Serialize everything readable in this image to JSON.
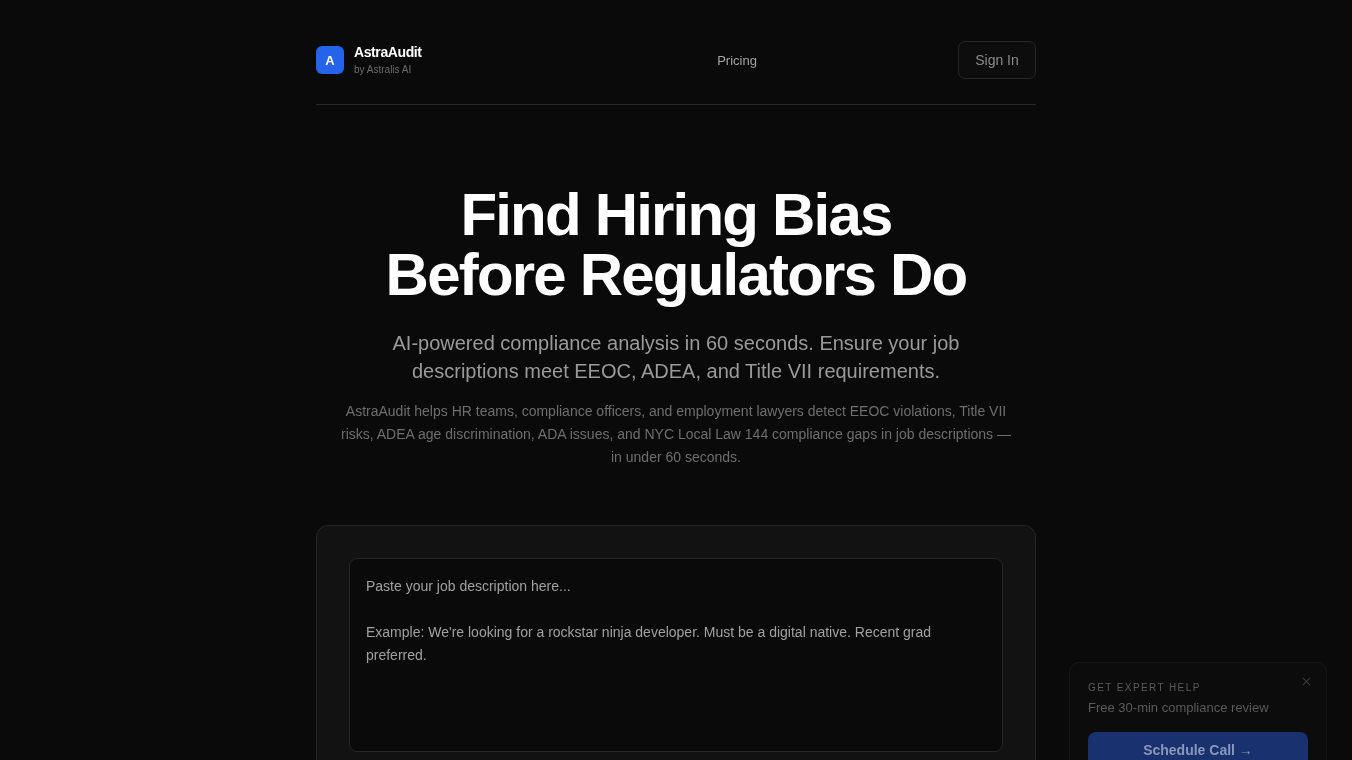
{
  "header": {
    "logo_letter": "A",
    "brand_name": "AstraAudit",
    "tagline": "by Astralis AI",
    "nav": [
      {
        "label": "Pricing"
      }
    ],
    "sign_in": "Sign In"
  },
  "hero": {
    "title_lines": [
      "Find Hiring Bias",
      "Before Regulators Do"
    ],
    "subtitle": "AI-powered compliance analysis in 60 seconds. Ensure your job descriptions meet EEOC, ADEA, and Title VII requirements.",
    "description": "AstraAudit helps HR teams, compliance officers, and employment lawyers detect EEOC violations, Title VII risks, ADEA age discrimination, ADA issues, and NYC Local Law 144 compliance gaps in job descriptions — in under 60 seconds."
  },
  "analyzer": {
    "placeholder": "Paste your job description here...\n\nExample: We're looking for a rockstar ninja developer. Must be a digital native. Recent grad preferred."
  },
  "expert_popup": {
    "eyebrow": "GET EXPERT HELP",
    "text": "Free 30-min compliance review",
    "button": "Schedule Call →"
  }
}
